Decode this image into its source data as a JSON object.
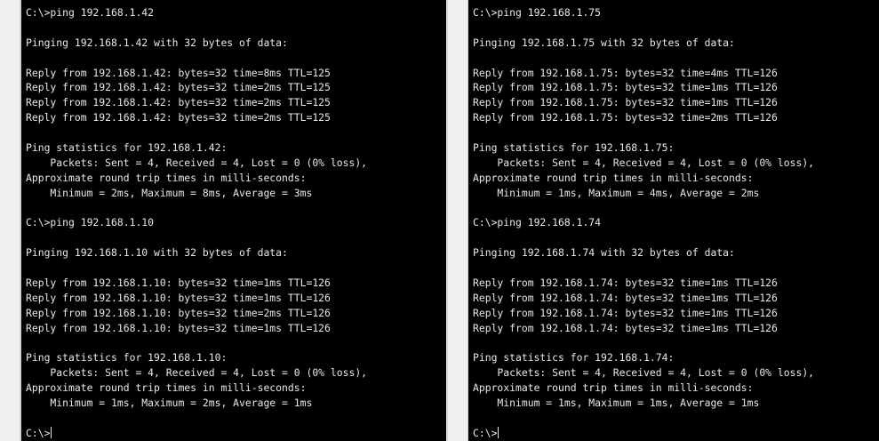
{
  "left_console": {
    "lines": [
      "C:\\>ping 192.168.1.42",
      "",
      "Pinging 192.168.1.42 with 32 bytes of data:",
      "",
      "Reply from 192.168.1.42: bytes=32 time=8ms TTL=125",
      "Reply from 192.168.1.42: bytes=32 time=2ms TTL=125",
      "Reply from 192.168.1.42: bytes=32 time=2ms TTL=125",
      "Reply from 192.168.1.42: bytes=32 time=2ms TTL=125",
      "",
      "Ping statistics for 192.168.1.42:",
      "    Packets: Sent = 4, Received = 4, Lost = 0 (0% loss),",
      "Approximate round trip times in milli-seconds:",
      "    Minimum = 2ms, Maximum = 8ms, Average = 3ms",
      "",
      "C:\\>ping 192.168.1.10",
      "",
      "Pinging 192.168.1.10 with 32 bytes of data:",
      "",
      "Reply from 192.168.1.10: bytes=32 time=1ms TTL=126",
      "Reply from 192.168.1.10: bytes=32 time=1ms TTL=126",
      "Reply from 192.168.1.10: bytes=32 time=2ms TTL=126",
      "Reply from 192.168.1.10: bytes=32 time=1ms TTL=126",
      "",
      "Ping statistics for 192.168.1.10:",
      "    Packets: Sent = 4, Received = 4, Lost = 0 (0% loss),",
      "Approximate round trip times in milli-seconds:",
      "    Minimum = 1ms, Maximum = 2ms, Average = 1ms",
      "",
      "C:\\>"
    ]
  },
  "right_console": {
    "lines": [
      "C:\\>ping 192.168.1.75",
      "",
      "Pinging 192.168.1.75 with 32 bytes of data:",
      "",
      "Reply from 192.168.1.75: bytes=32 time=4ms TTL=126",
      "Reply from 192.168.1.75: bytes=32 time=1ms TTL=126",
      "Reply from 192.168.1.75: bytes=32 time=1ms TTL=126",
      "Reply from 192.168.1.75: bytes=32 time=2ms TTL=126",
      "",
      "Ping statistics for 192.168.1.75:",
      "    Packets: Sent = 4, Received = 4, Lost = 0 (0% loss),",
      "Approximate round trip times in milli-seconds:",
      "    Minimum = 1ms, Maximum = 4ms, Average = 2ms",
      "",
      "C:\\>ping 192.168.1.74",
      "",
      "Pinging 192.168.1.74 with 32 bytes of data:",
      "",
      "Reply from 192.168.1.74: bytes=32 time=1ms TTL=126",
      "Reply from 192.168.1.74: bytes=32 time=1ms TTL=126",
      "Reply from 192.168.1.74: bytes=32 time=1ms TTL=126",
      "Reply from 192.168.1.74: bytes=32 time=1ms TTL=126",
      "",
      "Ping statistics for 192.168.1.74:",
      "    Packets: Sent = 4, Received = 4, Lost = 0 (0% loss),",
      "Approximate round trip times in milli-seconds:",
      "    Minimum = 1ms, Maximum = 1ms, Average = 1ms",
      "",
      "C:\\>"
    ]
  },
  "colors": {
    "terminal_bg": "#000000",
    "terminal_fg": "#e8e8e8",
    "window_bg": "#ececec"
  }
}
